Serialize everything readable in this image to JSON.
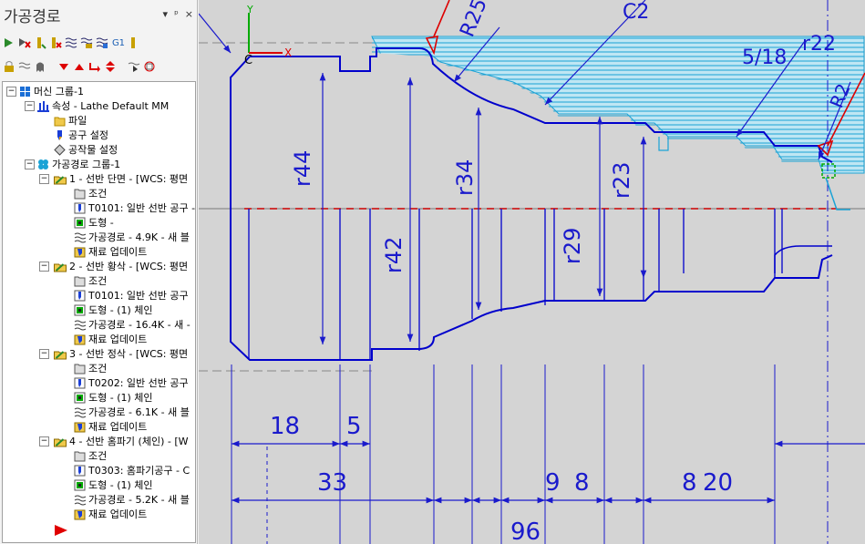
{
  "panel": {
    "title": "가공경로",
    "controls": [
      "▾",
      "ᵖ",
      "×"
    ],
    "g1_label": "G1"
  },
  "tree": {
    "machine_group": "머신 그룹-1",
    "properties": "속성 - Lathe Default MM",
    "files": "파일",
    "tool_settings": "공구 설정",
    "stock_setup": "공작물 설정",
    "toolpath_group": "가공경로 그룹-1",
    "operations": [
      {
        "title": "1 - 선반 단면 - [WCS: 평면",
        "params": "조건",
        "tool": "T0101: 일반 선반 공구 -",
        "geometry": "도형 -",
        "toolpath": "가공경로 - 4.9K - 새 블",
        "stock": "재료 업데이트"
      },
      {
        "title": "2 - 선반 황삭 - [WCS: 평면",
        "params": "조건",
        "tool": "T0101: 일반 선반 공구",
        "geometry": "도형 - (1) 체인",
        "toolpath": "가공경로 - 16.4K - 새 -",
        "stock": "재료 업데이트"
      },
      {
        "title": "3 - 선반 정삭 - [WCS: 평면",
        "params": "조건",
        "tool": "T0202: 일반 선반 공구",
        "geometry": "도형 - (1) 체인",
        "toolpath": "가공경로 - 6.1K - 새 블",
        "stock": "재료 업데이트"
      },
      {
        "title": "4 - 선반 홈파기 (체인) - [W",
        "params": "조건",
        "tool": "T0303: 홈파기공구 - C",
        "geometry": "도형 - (1) 체인",
        "toolpath": "가공경로 - 5.2K - 새 블",
        "stock": "재료 업데이트"
      }
    ]
  },
  "drawing": {
    "axis_y": "Y",
    "axis_x": "X",
    "origin": "C",
    "radius_labels": [
      "R25",
      "C2",
      "R2",
      "r22",
      "5/18"
    ],
    "dia_labels": [
      "r44",
      "r42",
      "r34",
      "r29",
      "r23"
    ],
    "dims_row1": [
      "18",
      "5"
    ],
    "dims_row2": [
      "33",
      "9",
      "8",
      "8",
      "20"
    ],
    "dims_row3": [
      "96"
    ]
  },
  "colors": {
    "part": "#0000cc",
    "toolpath": "#1aa3d6",
    "dims": "#1a1acc",
    "center": "#cc0000"
  }
}
